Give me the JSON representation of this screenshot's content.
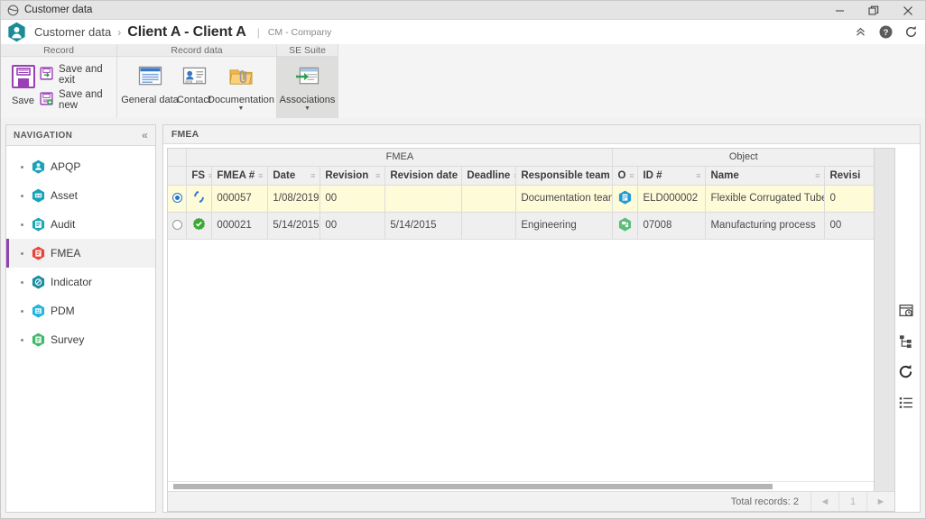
{
  "window": {
    "title": "Customer data",
    "icon": "globe-icon",
    "controls": {
      "minimize": "minimize-icon",
      "restore": "restore-icon",
      "close": "close-icon"
    }
  },
  "header": {
    "logo_icon": "user-hexagon-icon",
    "breadcrumb_root": "Customer data",
    "breadcrumb_separator": "›",
    "title": "Client A - Client A",
    "divider": "|",
    "subtitle": "CM - Company",
    "actions": [
      {
        "name": "collapse-ribbon-icon",
        "label": "«"
      },
      {
        "name": "help-icon",
        "label": "?"
      },
      {
        "name": "refresh-icon",
        "label": "↻"
      }
    ]
  },
  "ribbon": {
    "groups": [
      {
        "title": "Record",
        "big_button": {
          "label": "Save",
          "icon": "save-floppy-icon"
        },
        "small_buttons": [
          {
            "label": "Save and exit",
            "icon": "save-exit-icon"
          },
          {
            "label": "Save and new",
            "icon": "save-new-icon"
          }
        ]
      },
      {
        "title": "Record data",
        "tiles": [
          {
            "label": "General data",
            "icon": "general-data-icon",
            "has_caret": false,
            "active": false
          },
          {
            "label": "Contact",
            "icon": "contact-card-icon",
            "has_caret": false,
            "active": false
          },
          {
            "label": "Documentation",
            "icon": "documentation-folder-icon",
            "has_caret": true,
            "active": false
          }
        ]
      },
      {
        "title": "SE Suite",
        "tiles": [
          {
            "label": "Associations",
            "icon": "associations-icon",
            "has_caret": true,
            "active": true
          }
        ]
      }
    ]
  },
  "sidebar": {
    "header": "NAVIGATION",
    "collapse_icon": "«",
    "items": [
      {
        "label": "APQP",
        "icon": "apqp-hexagon-icon",
        "color": "#17a2b8",
        "active": false
      },
      {
        "label": "Asset",
        "icon": "asset-hexagon-icon",
        "color": "#17a2b8",
        "active": false
      },
      {
        "label": "Audit",
        "icon": "audit-hexagon-icon",
        "color": "#1ba7b5",
        "active": false
      },
      {
        "label": "FMEA",
        "icon": "fmea-hexagon-icon",
        "color": "#e8443a",
        "active": true
      },
      {
        "label": "Indicator",
        "icon": "indicator-hexagon-icon",
        "color": "#1c8e9e",
        "active": false
      },
      {
        "label": "PDM",
        "icon": "pdm-hexagon-icon",
        "color": "#28b4e0",
        "active": false
      },
      {
        "label": "Survey",
        "icon": "survey-hexagon-icon",
        "color": "#42b86a",
        "active": false
      }
    ]
  },
  "main": {
    "tab_label": "FMEA",
    "grid": {
      "group_headers": [
        {
          "label": "",
          "span": 1
        },
        {
          "label": "FMEA",
          "span": 7
        },
        {
          "label": "Object",
          "span": 4
        }
      ],
      "columns": [
        {
          "key": "select",
          "label": "",
          "sortable": false
        },
        {
          "key": "fs",
          "label": "FS",
          "sortable": true
        },
        {
          "key": "fmea_no",
          "label": "FMEA #",
          "sortable": true
        },
        {
          "key": "date",
          "label": "Date",
          "sortable": true
        },
        {
          "key": "revision",
          "label": "Revision",
          "sortable": true
        },
        {
          "key": "revision_date",
          "label": "Revision date",
          "sortable": true
        },
        {
          "key": "deadline",
          "label": "Deadline",
          "sortable": true
        },
        {
          "key": "responsible_team",
          "label": "Responsible team",
          "sortable": true
        },
        {
          "key": "o",
          "label": "O",
          "sortable": true
        },
        {
          "key": "id_no",
          "label": "ID #",
          "sortable": true
        },
        {
          "key": "name",
          "label": "Name",
          "sortable": true
        },
        {
          "key": "obj_revision",
          "label": "Revisi",
          "sortable": false
        }
      ],
      "rows": [
        {
          "selected": true,
          "status_icon": "in-revision-cycle-icon",
          "status_color": "#2a6fd6",
          "fmea_no": "000057",
          "date": "1/08/2019",
          "revision": "00",
          "revision_date": "",
          "deadline": "",
          "responsible_team": "Documentation team",
          "object_icon": "document-hexagon-icon",
          "object_color": "#1f9bd1",
          "id_no": "ELD000002",
          "name": "Flexible Corrugated Tubes",
          "obj_revision": "0"
        },
        {
          "selected": false,
          "status_icon": "approved-gear-icon",
          "status_color": "#3aaa35",
          "fmea_no": "000021",
          "date": "5/14/2015",
          "revision": "00",
          "revision_date": "5/14/2015",
          "deadline": "",
          "responsible_team": "Engineering",
          "object_icon": "process-hexagon-icon",
          "object_color": "#5cbd7a",
          "id_no": "07008",
          "name": "Manufacturing process",
          "obj_revision": "00"
        }
      ],
      "footer": {
        "total_records": "Total records: 2",
        "prev_label": "◄",
        "page_label": "1",
        "next_label": "►"
      }
    },
    "rail_icons": [
      {
        "name": "history-window-icon"
      },
      {
        "name": "hierarchy-tree-icon"
      },
      {
        "name": "refresh-icon"
      },
      {
        "name": "list-view-icon"
      }
    ]
  }
}
